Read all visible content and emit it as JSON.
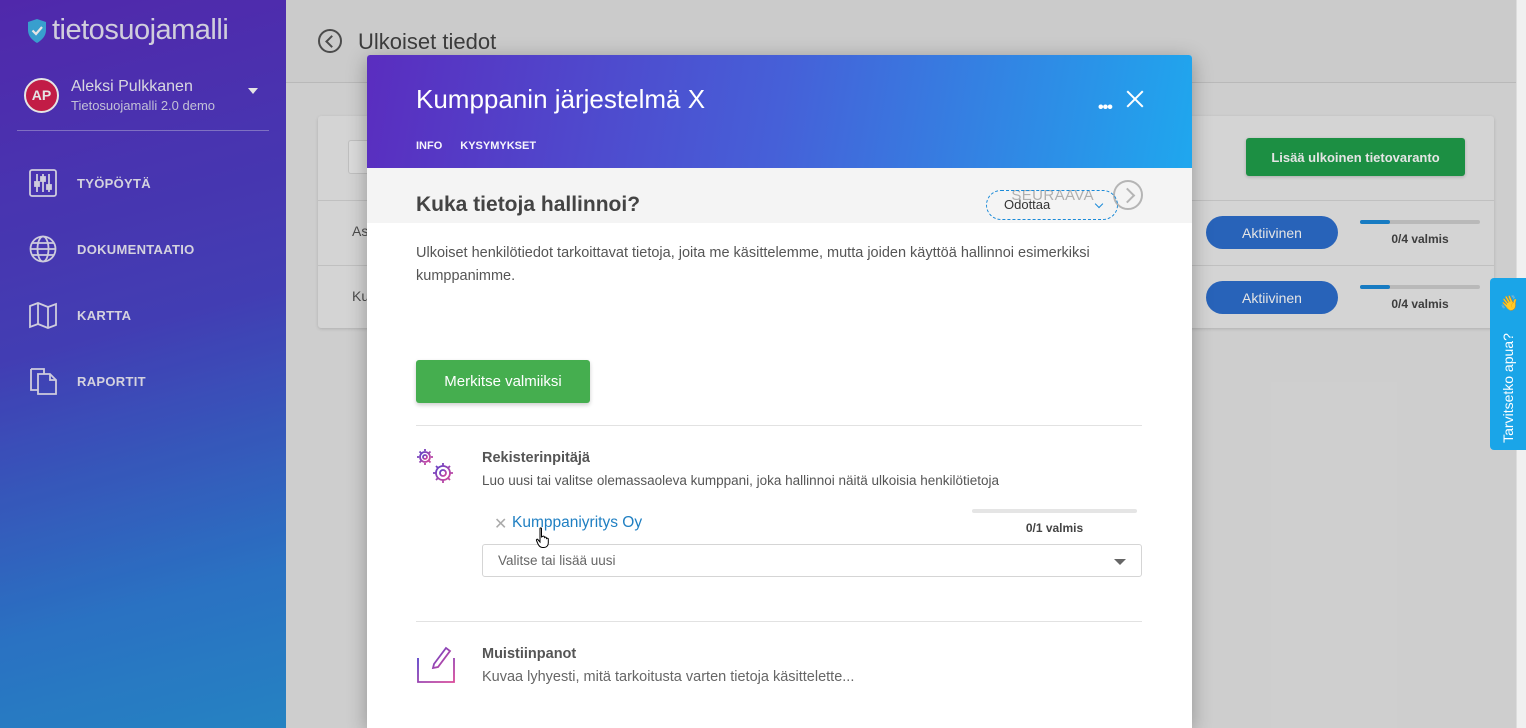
{
  "app": {
    "logo_text": "tietosuojamalli"
  },
  "user": {
    "initials": "AP",
    "name": "Aleksi Pulkkanen",
    "org": "Tietosuojamalli 2.0 demo"
  },
  "sidebar": {
    "items": [
      {
        "label": "TYÖPÖYTÄ",
        "icon": "sliders-icon"
      },
      {
        "label": "DOKUMENTAATIO",
        "icon": "globe-icon"
      },
      {
        "label": "KARTTA",
        "icon": "map-icon"
      },
      {
        "label": "RAPORTIT",
        "icon": "documents-icon"
      }
    ]
  },
  "page": {
    "title": "Ulkoiset tiedot",
    "add_button": "Lisää ulkoinen tietovaranto",
    "rows": [
      {
        "name_partial": "As",
        "status": "Aktiivinen",
        "progress_text": "0/4 valmis",
        "progress": 0.25
      },
      {
        "name_partial": "Ku",
        "status": "Aktiivinen",
        "progress_text": "0/4 valmis",
        "progress": 0.25
      }
    ]
  },
  "help_tab": {
    "label": "Tarvitsetko apua?",
    "emoji": "👋"
  },
  "modal": {
    "title": "Kumppanin järjestelmä X",
    "more": "•••",
    "tabs": [
      "INFO",
      "KYSYMYKSET"
    ],
    "next_label": "SEURAAVA",
    "question_title": "Kuka tietoja hallinnoi?",
    "status_value": "Odottaa",
    "description": "Ulkoiset henkilötiedot tarkoittavat tietoja, joita me käsittelemme, mutta joiden käyttöä hallinnoi esimerkiksi kumppanimme.",
    "mark_done_button": "Merkitse valmiiksi",
    "controller": {
      "title": "Rekisterinpitäjä",
      "description": "Luo uusi tai valitse olemassaoleva kumppani, joka hallinnoi näitä ulkoisia henkilötietoja",
      "selected": {
        "remove": "✕",
        "name": "Kumppaniyritys Oy",
        "progress_text": "0/1 valmis",
        "progress": 0
      },
      "combo_placeholder": "Valitse tai lisää uusi"
    },
    "notes": {
      "title": "Muistiinpanot",
      "placeholder": "Kuvaa lyhyesti, mitä tarkoitusta varten tietoja käsittelette..."
    }
  },
  "colors": {
    "accent_green": "#45ae4f",
    "status_blue": "#2d6fcf",
    "link": "#1f7fc2",
    "help_tab": "#1aa5e8"
  }
}
